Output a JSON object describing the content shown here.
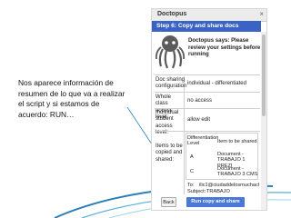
{
  "caption": {
    "text": "Nos aparece información de resumen de lo que va a realizar el script y si estamos de acuerdo: RUN…"
  },
  "dialog": {
    "app_title": "Doctopus",
    "close_glyph": "×",
    "step_title": "Step 6: Copy and share docs",
    "says": "Doctopus says: Please review your settings before running"
  },
  "summary": {
    "sharing_config_label": "Doc sharing configuration",
    "sharing_config_value": "individual - differentiated",
    "whole_class_label": "Whole class access level:",
    "whole_class_value": "no access",
    "individual_label": "Individual student access level:",
    "individual_value": "allow edit",
    "items_label": "Items to be copied and shared:",
    "items_table": {
      "col1_header": "Differentiation Level",
      "col2_header": "Item to be shared",
      "rows": [
        {
          "level": "A",
          "item": "Document - TRABAJO 1 PREZI"
        },
        {
          "level": "C",
          "item": "Document - TRABAJO 3 CMS"
        }
      ]
    },
    "to_label": "To:",
    "to_value": "ilic1@ciudaddelosmuchachos",
    "subject_label": "Subject:",
    "subject_value": "TRABAJO"
  },
  "buttons": {
    "back": "Back",
    "run": "Run copy and share"
  },
  "colors": {
    "step_bar": "#3b63c3",
    "run_button": "#4a78d9",
    "accent_swoosh": "#2b7fb8"
  }
}
